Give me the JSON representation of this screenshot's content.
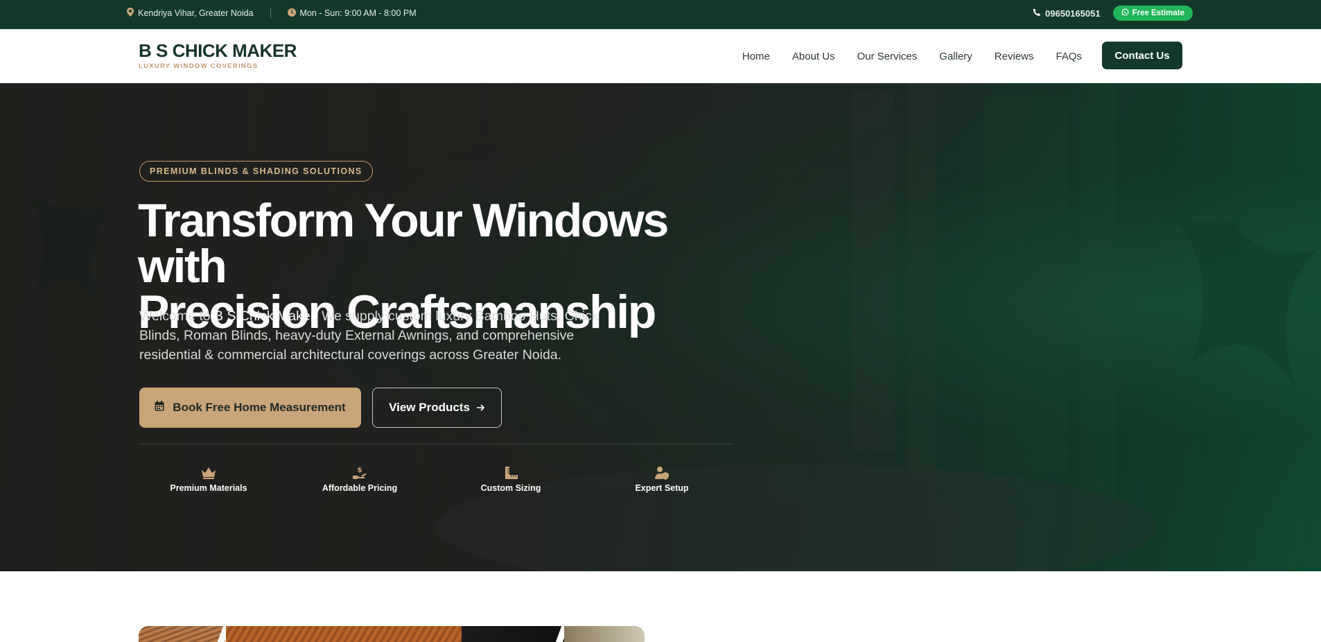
{
  "topbar": {
    "location": "Kendriya Vihar, Greater Noida",
    "hours": "Mon - Sun: 9:00 AM - 8:00 PM",
    "phone": "09650165051",
    "estimate_label": "Free Estimate",
    "icons": {
      "location": "map-pin-icon",
      "hours": "clock-icon",
      "phone": "phone-icon",
      "estimate": "whatsapp-icon"
    }
  },
  "header": {
    "brand": "B S CHICK MAKER",
    "tagline": "LUXURY WINDOW COVERINGS",
    "nav": [
      "Home",
      "About Us",
      "Our Services",
      "Gallery",
      "Reviews",
      "FAQs"
    ],
    "contact_label": "Contact Us"
  },
  "hero": {
    "badge": "PREMIUM BLINDS & SHADING SOLUTIONS",
    "headline_line1": "Transform Your Windows with",
    "headline_line2": "Precision Craftsmanship",
    "lead_prefix": "Welcome to ",
    "lead_brand": "B S Chick Maker",
    "lead_rest": ". We supply custom luxury Bamboo Huts, Chick Blinds, Roman Blinds, heavy-duty External Awnings, and comprehensive residential & commercial architectural coverings across Greater Noida.",
    "primary_cta": "Book Free Home Measurement",
    "secondary_cta": "View Products",
    "cta_icons": {
      "primary": "calendar-icon",
      "secondary": "arrow-right-icon"
    },
    "features": [
      {
        "label": "Premium Materials",
        "icon": "crown-icon"
      },
      {
        "label": "Affordable Pricing",
        "icon": "hand-dollar-icon"
      },
      {
        "label": "Custom Sizing",
        "icon": "ruler-icon"
      },
      {
        "label": "Expert Setup",
        "icon": "user-shield-icon"
      }
    ]
  },
  "colors": {
    "topbar_bg": "#14382a",
    "brand_green": "#16352a",
    "accent_gold": "#c9a57a",
    "whatsapp_green": "#20b559"
  }
}
